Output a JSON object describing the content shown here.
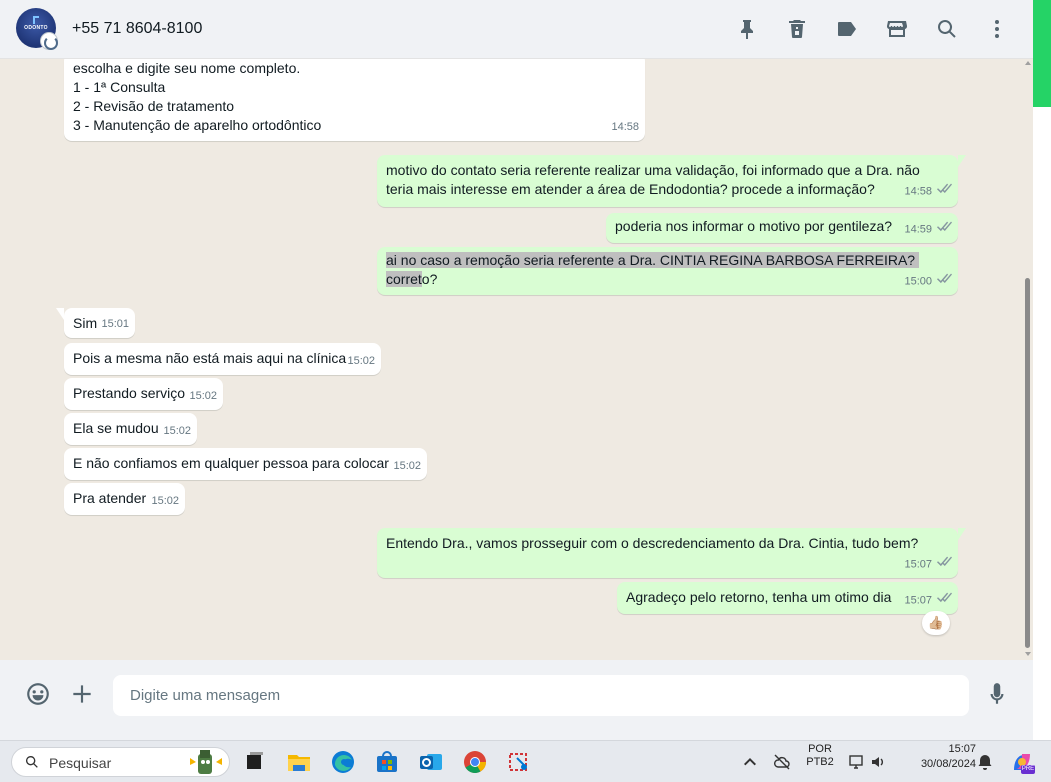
{
  "header": {
    "contact_name": "+55 71 8604-8100",
    "avatar_text": "ODONTO",
    "icons": [
      "pin-icon",
      "delete-icon",
      "label-icon",
      "store-icon",
      "search-icon",
      "more-icon"
    ]
  },
  "messages": [
    {
      "dir": "in",
      "text": "escolha e digite seu nome completo.\n1 - 1ª Consulta\n2 - Revisão de tratamento\n3 - Manutenção de aparelho ortodôntico",
      "time": "14:58"
    },
    {
      "dir": "out",
      "text": "motivo do contato seria referente realizar uma validação, foi informado que a Dra. não\nteria mais interesse em atender a área de Endodontia? procede a informação?",
      "time": "14:58"
    },
    {
      "dir": "out",
      "text": "poderia nos informar o motivo por gentileza?",
      "time": "14:59"
    },
    {
      "dir": "out",
      "text_highlight": "ai no caso a remoção seria referente a Dra. CINTIA REGINA BARBOSA FERREIRA? corret",
      "text_rest": "o?",
      "time": "15:00"
    },
    {
      "dir": "in",
      "text": "Sim",
      "time": "15:01"
    },
    {
      "dir": "in",
      "text": "Pois a mesma não está mais aqui na clínica",
      "time": "15:02"
    },
    {
      "dir": "in",
      "text": "Prestando serviço",
      "time": "15:02"
    },
    {
      "dir": "in",
      "text": "Ela se mudou",
      "time": "15:02"
    },
    {
      "dir": "in",
      "text": "E não confiamos em qualquer pessoa para colocar",
      "time": "15:02"
    },
    {
      "dir": "in",
      "text": "Pra atender",
      "time": "15:02"
    },
    {
      "dir": "out",
      "text": "Entendo Dra., vamos prosseguir com o descredenciamento da Dra. Cintia, tudo bem?",
      "time": "15:07"
    },
    {
      "dir": "out",
      "text": "Agradeço pelo retorno, tenha um otimo dia",
      "time": "15:07"
    }
  ],
  "reaction": "👍🏼",
  "composer": {
    "placeholder": "Digite uma mensagem"
  },
  "taskbar": {
    "search_label": "Pesquisar",
    "language": "POR",
    "layout": "PTB2",
    "time": "15:07",
    "date": "30/08/2024",
    "copilot_badge": "PRE"
  },
  "colors": {
    "incoming": "#ffffff",
    "outgoing": "#d9fdd3",
    "chat_bg": "#efeae2",
    "accent": "#25d366",
    "header_bg": "#f0f2f5"
  }
}
